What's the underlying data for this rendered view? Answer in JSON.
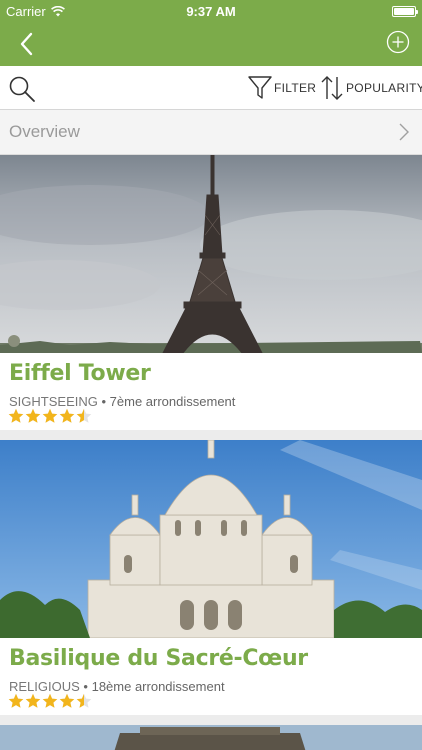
{
  "status": {
    "carrier": "Carrier",
    "time": "9:37 AM"
  },
  "toolbar": {
    "filter_label": "FILTER",
    "sort_label": "POPULARITY"
  },
  "overview": {
    "label": "Overview"
  },
  "places": [
    {
      "title": "Eiffel Tower",
      "category": "SIGHTSEEING",
      "district": "7ème arrondissement",
      "rating": 4.5
    },
    {
      "title": "Basilique du Sacré-Cœur",
      "category": "RELIGIOUS",
      "district": "18ème arrondissement",
      "rating": 4.5
    }
  ],
  "colors": {
    "brand_green": "#7cab4a",
    "star_gold": "#f2b51c"
  },
  "icons": [
    "back-chevron-icon",
    "add-circle-icon",
    "search-icon",
    "filter-funnel-icon",
    "sort-arrows-icon",
    "chevron-right-icon",
    "star-icon"
  ]
}
